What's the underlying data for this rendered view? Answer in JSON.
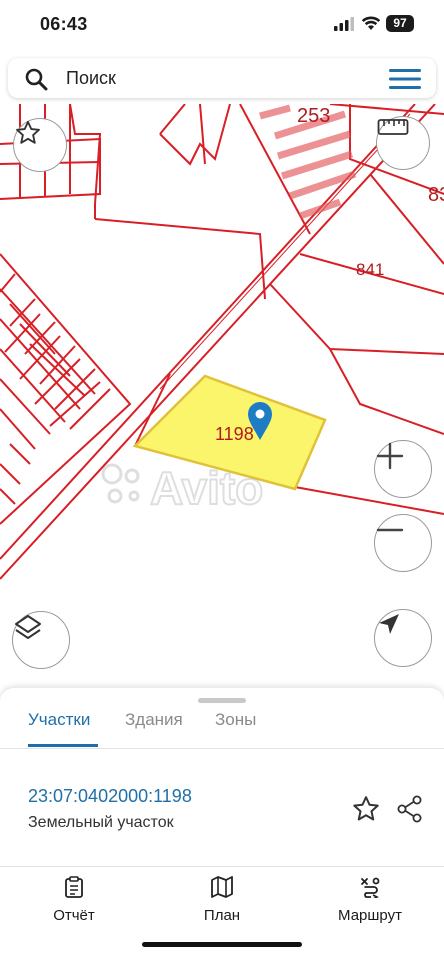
{
  "status_bar": {
    "time": "06:43",
    "battery": "97"
  },
  "search": {
    "placeholder": "Поиск"
  },
  "map": {
    "labels": {
      "block_253": "253",
      "block_841": "841",
      "block_83": "83",
      "parcel": "1198"
    },
    "watermark": "Avito",
    "colors": {
      "cadastral_lines": "#d81f26",
      "selected_parcel_fill": "#fbf56b",
      "pin": "#1d7cc4"
    }
  },
  "sheet": {
    "tabs": [
      {
        "label": "Участки",
        "active": true
      },
      {
        "label": "Здания",
        "active": false
      },
      {
        "label": "Зоны",
        "active": false
      }
    ],
    "parcel": {
      "cadastral_number": "23:07:0402000:1198",
      "type": "Земельный участок"
    }
  },
  "bottom_nav": [
    {
      "label": "Отчёт",
      "icon": "report-icon"
    },
    {
      "label": "План",
      "icon": "map-icon"
    },
    {
      "label": "Маршрут",
      "icon": "route-icon"
    }
  ]
}
